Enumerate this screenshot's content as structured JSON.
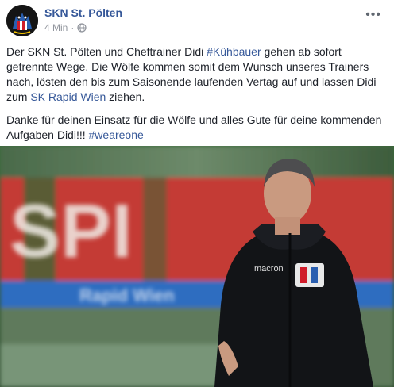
{
  "post": {
    "page_name": "SKN St. Pölten",
    "time": "4 Min",
    "separator": "·",
    "more_label": "•••",
    "p1_part1": "Der SKN St. Pölten und Cheftrainer Didi ",
    "p1_hashtag": "#Kühbauer",
    "p1_part2": " gehen ab sofort getrennte Wege. Die Wölfe kommen somit dem Wunsch unseres Trainers nach, lösten den bis zum Saisonende laufenden Vertag auf und lassen Didi zum ",
    "p1_link": "SK Rapid Wien",
    "p1_part3": " ziehen.",
    "p2_part1": "Danke für deinen Einsatz für die Wölfe und alles Gute für deine kommenden Aufgaben Didi!!! ",
    "p2_hashtag": "#weareone"
  },
  "photo": {
    "banner_text": "SPI",
    "banner_sub": "Rapid Wien",
    "jacket_brand": "macron"
  },
  "colors": {
    "link": "#365899",
    "meta": "#90949c"
  }
}
